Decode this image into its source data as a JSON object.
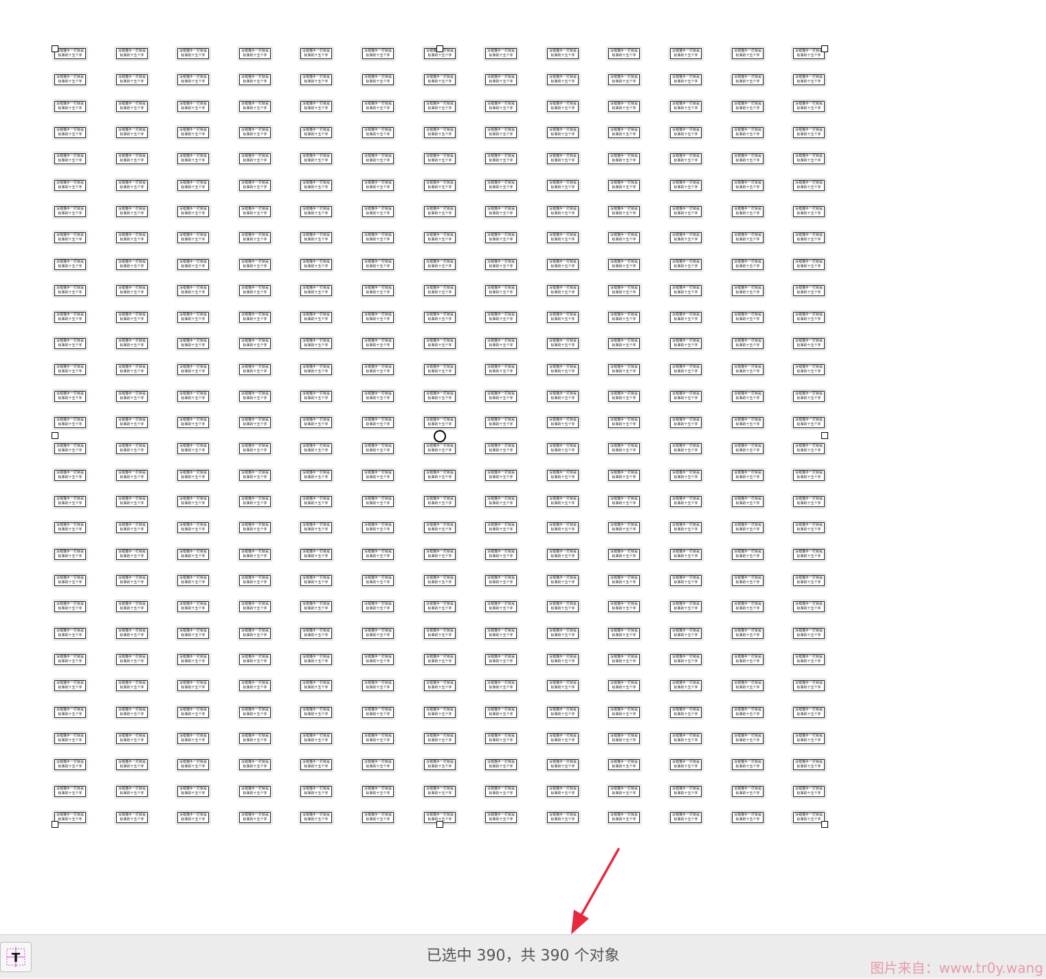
{
  "canvas": {
    "textbox_line1": "没错猫手一打就是",
    "textbox_line2": "标准的十五个字",
    "rows": 30,
    "cols": 13
  },
  "statusbar": {
    "status_text": "已选中 390，共 390 个对象",
    "tool_icon": "text-tool-icon"
  },
  "watermark": "图片来自：www.tr0y.wang",
  "colors": {
    "arrow": "#e8283c",
    "statusbar_bg": "#ececec",
    "tool_icon_accent": "#d63fd6"
  }
}
